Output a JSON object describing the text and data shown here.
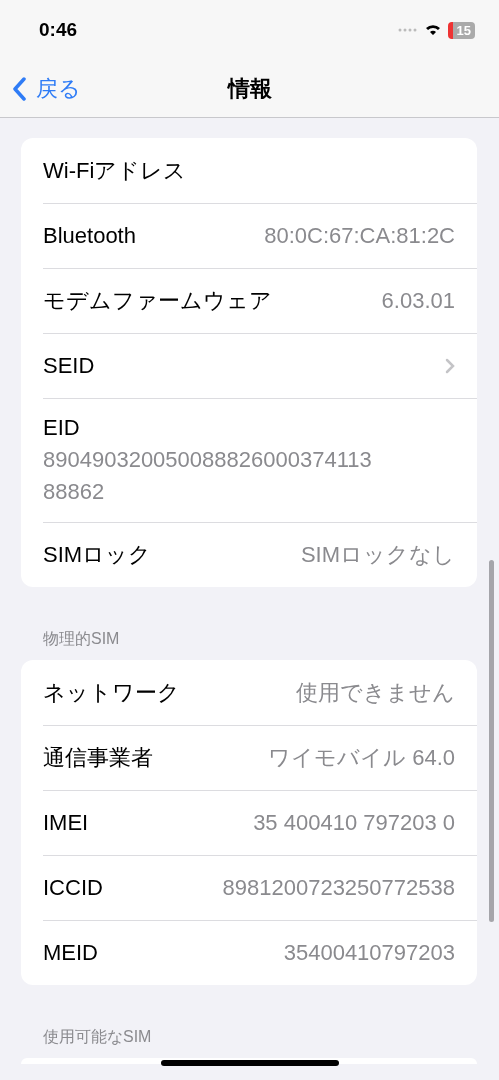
{
  "status_bar": {
    "time": "0:46",
    "battery": "15"
  },
  "nav": {
    "back": "戻る",
    "title": "情報"
  },
  "sections": [
    {
      "rows": [
        {
          "kind": "value",
          "label": "Wi-Fiアドレス"
        },
        {
          "kind": "value",
          "label": "Bluetooth",
          "value": "80:0C:67:CA:81:2C"
        },
        {
          "kind": "value",
          "label": "モデムファームウェア",
          "value": "6.03.01"
        },
        {
          "kind": "chevron",
          "label": "SEID"
        },
        {
          "kind": "block",
          "label": "EID",
          "value": "89049032005008882600037411388862"
        },
        {
          "kind": "value",
          "label": "SIMロック",
          "value": "SIMロックなし"
        }
      ]
    },
    {
      "header": "物理的SIM",
      "rows": [
        {
          "kind": "value",
          "label": "ネットワーク",
          "value": "使用できません"
        },
        {
          "kind": "value",
          "label": "通信事業者",
          "value": "ワイモバイル 64.0"
        },
        {
          "kind": "value",
          "label": "IMEI",
          "value": "35 400410 797203 0"
        },
        {
          "kind": "value",
          "label": "ICCID",
          "value": "8981200723250772538"
        },
        {
          "kind": "value",
          "label": "MEID",
          "value": "35400410797203"
        }
      ]
    },
    {
      "header": "使用可能なSIM"
    }
  ]
}
